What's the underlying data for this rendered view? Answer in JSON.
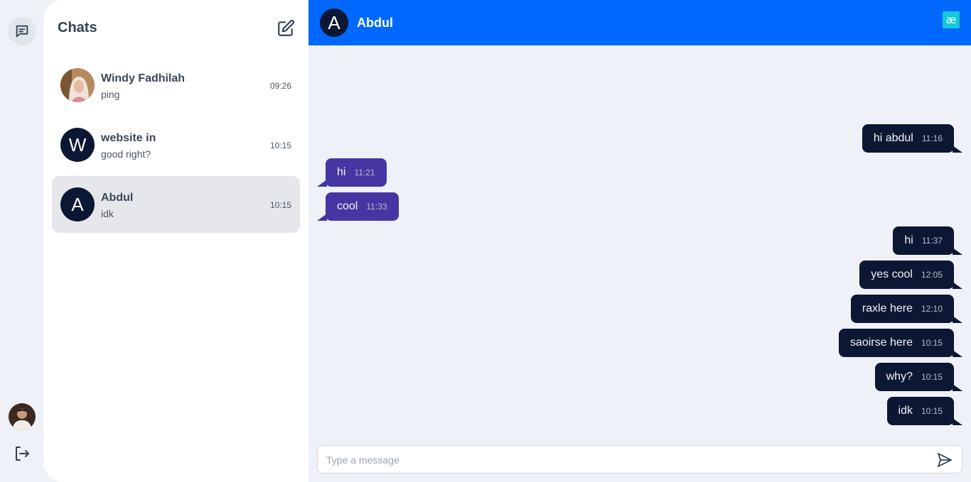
{
  "rail": {
    "chat_icon": "chat-bubble-icon",
    "logout_icon": "logout-icon"
  },
  "chats_panel": {
    "title": "Chats",
    "compose_icon": "edit-icon",
    "items": [
      {
        "name": "Windy Fadhilah",
        "preview": "ping",
        "time": "09:26",
        "avatar_initial": ""
      },
      {
        "name": "website in",
        "preview": "good right?",
        "time": "10:15",
        "avatar_initial": "W"
      },
      {
        "name": "Abdul",
        "preview": "idk",
        "time": "10:15",
        "avatar_initial": "A"
      }
    ]
  },
  "conversation": {
    "name": "Abdul",
    "avatar_initial": "A",
    "brand_badge": "æ",
    "messages": [
      {
        "text": "hi abdul",
        "time": "11:16",
        "direction": "out"
      },
      {
        "text": "hi",
        "time": "11:21",
        "direction": "in"
      },
      {
        "text": "cool",
        "time": "11:33",
        "direction": "in"
      },
      {
        "text": "hi",
        "time": "11:37",
        "direction": "out"
      },
      {
        "text": "yes cool",
        "time": "12:05",
        "direction": "out"
      },
      {
        "text": "raxle here",
        "time": "12:10",
        "direction": "out"
      },
      {
        "text": "saoirse here",
        "time": "10:15",
        "direction": "out"
      },
      {
        "text": "why?",
        "time": "10:15",
        "direction": "out"
      },
      {
        "text": "idk",
        "time": "10:15",
        "direction": "out"
      }
    ]
  },
  "composer": {
    "placeholder": "Type a message",
    "send_icon": "send-icon"
  },
  "colors": {
    "header": "#0068ff",
    "outgoing_bubble": "#0b1733",
    "incoming_bubble": "#4536a3",
    "active_chat": "#e6e7eb",
    "brand_badge": "#13c9d8"
  }
}
